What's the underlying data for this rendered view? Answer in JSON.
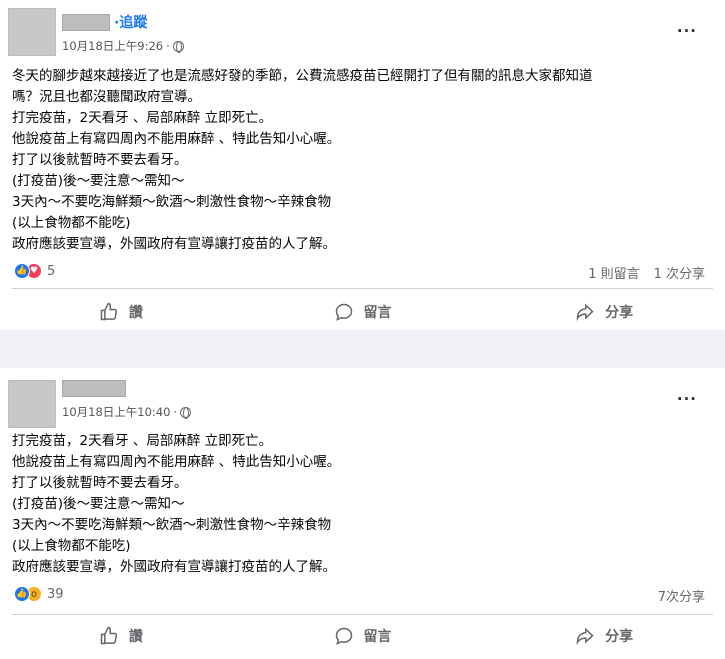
{
  "post1": {
    "follow_label": "追蹤",
    "separator": "·",
    "timestamp": "10月18日上午9:26",
    "more_label": "···",
    "lines": [
      "冬天的腳步越來越接近了也是流感好發的季節，公費流感疫苗已經開打了但有關的訊息大家都知道",
      "嗎？況且也都沒聽聞政府宣導。",
      "打完疫苗，2天看牙 、局部麻醉 立即死亡。",
      "他說疫苗上有寫四周內不能用麻醉 、特此告知小心喔。",
      "打了以後就暫時不要去看牙。",
      "(打疫苗)後～要注意～需知～",
      "3天內～不要吃海鮮類～飲酒～刺激性食物～辛辣食物",
      "(以上食物都不能吃)",
      "政府應該要宣導，外國政府有宣導讓打疫苗的人了解。"
    ],
    "reaction_count": "5",
    "comments": "1 則留言",
    "shares": "1 次分享",
    "reaction_icons": [
      "like-icon",
      "love-icon"
    ]
  },
  "post2": {
    "timestamp": "10月18日上午10:40",
    "more_label": "···",
    "lines": [
      "打完疫苗，2天看牙 、局部麻醉 立即死亡。",
      "他說疫苗上有寫四周內不能用麻醉 、特此告知小心喔。",
      "打了以後就暫時不要去看牙。",
      "(打疫苗)後～要注意～需知～",
      "3天內～不要吃海鮮類～飲酒～刺激性食物～辛辣食物",
      "(以上食物都不能吃)",
      "政府應該要宣導，外國政府有宣導讓打疫苗的人了解。"
    ],
    "reaction_count": "39",
    "shares": "7次分享",
    "reaction_icons": [
      "like-icon",
      "wow-icon"
    ]
  },
  "actions": {
    "like": "讚",
    "comment": "留言",
    "share": "分享"
  },
  "colors": {
    "accent": "#1877f2",
    "love": "#f33e58",
    "wow": "#f7b125",
    "secondary_text": "#65676b",
    "background": "#f0f2f5"
  }
}
